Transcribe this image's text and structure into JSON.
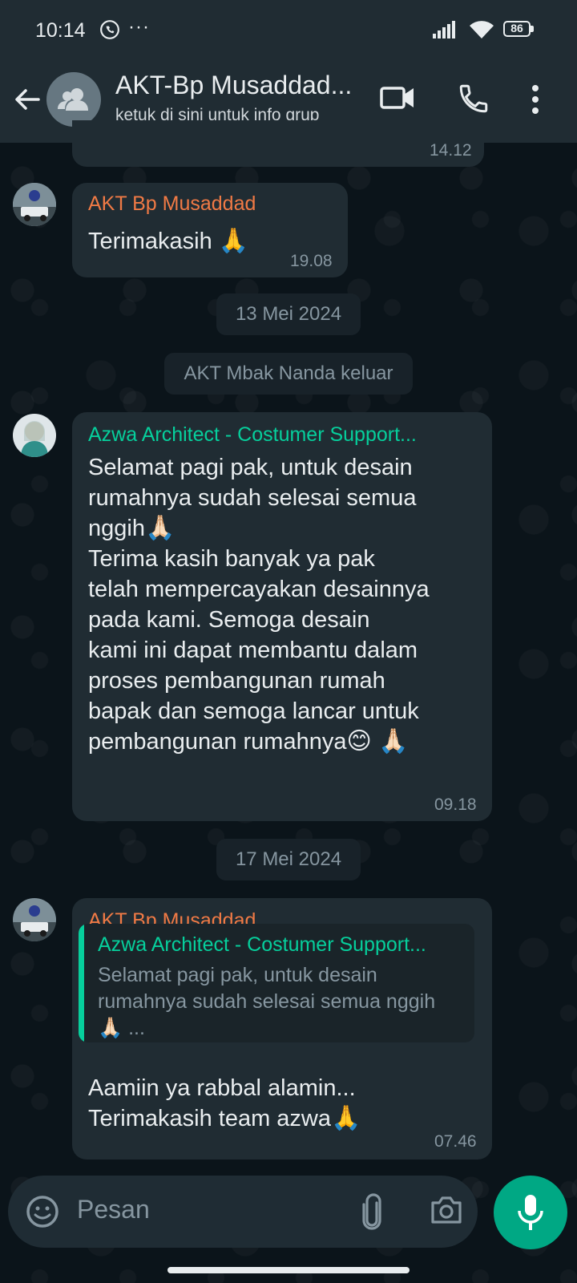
{
  "status_bar": {
    "time": "10:14",
    "dots": "···",
    "battery": "86"
  },
  "header": {
    "title": "AKT-Bp Musaddad...",
    "subtitle": "ketuk di sini untuk info grup"
  },
  "messages": {
    "top_partial_time": "14.12",
    "m1": {
      "sender": "AKT Bp Musaddad",
      "text": "Terimakasih",
      "emoji": "🙏",
      "time": "19.08"
    },
    "date1": "13 Mei 2024",
    "system1": "AKT Mbak Nanda keluar",
    "m2": {
      "sender": "Azwa Architect - Costumer Support...",
      "para1_lines": [
        "Selamat pagi pak, untuk desain",
        "rumahnya sudah selesai semua",
        "nggih"
      ],
      "para1_emoji": "🙏🏻",
      "para2_lines": [
        "Terima kasih banyak ya pak",
        "telah mempercayakan desainnya",
        "pada kami. Semoga desain",
        "kami ini dapat membantu dalam",
        "proses pembangunan rumah",
        "bapak dan semoga lancar untuk",
        "pembangunan rumahnya"
      ],
      "para2_emoji": "😊 🙏🏻",
      "time": "09.18"
    },
    "date2": "17 Mei 2024",
    "m3": {
      "sender": "AKT Bp Musaddad",
      "quote_sender": "Azwa Architect - Costumer Support...",
      "quote_lines": [
        "Selamat pagi pak, untuk desain",
        "rumahnya sudah selesai semua nggih",
        "🙏🏻 ..."
      ],
      "lines": [
        "Aamiin ya rabbal alamin...",
        "Terimakasih team azwa"
      ],
      "emoji": "🙏",
      "time": "07.46"
    }
  },
  "composer": {
    "placeholder": "Pesan"
  },
  "colors": {
    "orange_sender": "#f07a45",
    "teal_sender": "#06cf9c",
    "bubble": "#202c33",
    "accent": "#00a884"
  },
  "icons": [
    "back-arrow-icon",
    "group-icon",
    "video-call-icon",
    "phone-icon",
    "more-vert-icon",
    "emoji-icon",
    "attach-icon",
    "camera-icon",
    "mic-icon",
    "whatsapp-icon",
    "signal-icon",
    "wifi-icon",
    "battery-icon"
  ]
}
